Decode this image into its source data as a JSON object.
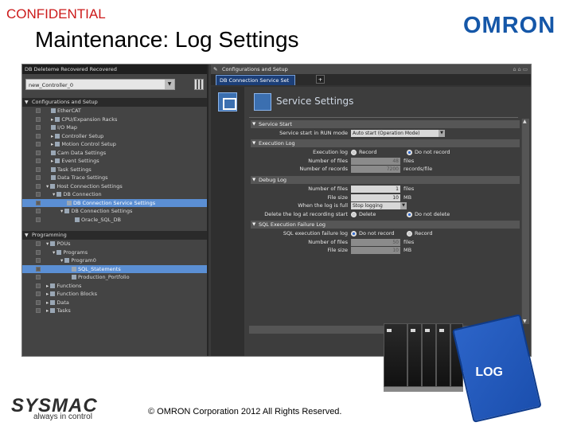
{
  "slide": {
    "confidential": "CONFIDENTIAL",
    "title": "Maintenance: Log Settings",
    "brand": "OMRON",
    "footer_brand": "SYSMAC",
    "footer_tagline": "always in control",
    "copyright": "© OMRON Corporation 2012 All Rights Reserved.",
    "card_label": "LOG"
  },
  "left_panel": {
    "title": "DB Deleteme Recovered Recovered",
    "controller": "new_Controller_0",
    "sections": [
      {
        "label": "Configurations and Setup"
      },
      {
        "label": "Programming"
      }
    ],
    "items": [
      {
        "label": "EtherCAT"
      },
      {
        "label": "CPU/Expansion Racks"
      },
      {
        "label": "I/O Map"
      },
      {
        "label": "Controller Setup"
      },
      {
        "label": "Motion Control Setup"
      },
      {
        "label": "Cam Data Settings"
      },
      {
        "label": "Event Settings"
      },
      {
        "label": "Task Settings"
      },
      {
        "label": "Data Trace Settings"
      },
      {
        "label": "Host Connection Settings"
      },
      {
        "label": "DB Connection"
      },
      {
        "label": "DB Connection Service Settings"
      },
      {
        "label": "DB Connection Settings"
      },
      {
        "label": "Oracle_SQL_DB"
      },
      {
        "label": "POUs"
      },
      {
        "label": "Programs"
      },
      {
        "label": "Program0"
      },
      {
        "label": "SQL_Statements"
      },
      {
        "label": "Production_Portfolio"
      },
      {
        "label": "Functions"
      },
      {
        "label": "Function Blocks"
      },
      {
        "label": "Data"
      },
      {
        "label": "Tasks"
      }
    ]
  },
  "right_panel": {
    "title": "Configurations and Setup",
    "tab": "DB Connection Service Set",
    "tab_add": "+",
    "window_controls": "⌂ ⌂ ▭",
    "service_settings": "Service Settings",
    "service_start": {
      "header": "Service Start",
      "label": "Service start in RUN mode",
      "value": "Auto start (Operation Mode)"
    },
    "execution_log": {
      "header": "Execution Log",
      "log_label": "Execution log",
      "opt_record": "Record",
      "opt_do_not_record": "Do not record",
      "files_label": "Number of files",
      "files_value": "48",
      "files_unit": "files",
      "records_label": "Number of records",
      "records_value": "7200",
      "records_unit": "records/file"
    },
    "debug_log": {
      "header": "Debug Log",
      "files_label": "Number of files",
      "files_value": "1",
      "files_unit": "files",
      "size_label": "File size",
      "size_value": "10",
      "size_unit": "MB",
      "full_label": "When the log is full",
      "full_value": "Stop logging",
      "delete_label": "Delete the log at recording start",
      "opt_delete": "Delete",
      "opt_do_not_delete": "Do not delete"
    },
    "sql_failure_log": {
      "header": "SQL Execution Failure Log",
      "log_label": "SQL execution failure log",
      "value": "Do not record",
      "opt_record": "Record",
      "files_label": "Number of files",
      "files_value": "50",
      "files_unit": "files",
      "size_label": "File size",
      "size_value": "10",
      "size_unit": "MB"
    }
  },
  "colors": {
    "confidential": "#cc1a1a",
    "brand": "#1557a8",
    "selection": "#5b8fd4",
    "card": "#2c64c8"
  }
}
